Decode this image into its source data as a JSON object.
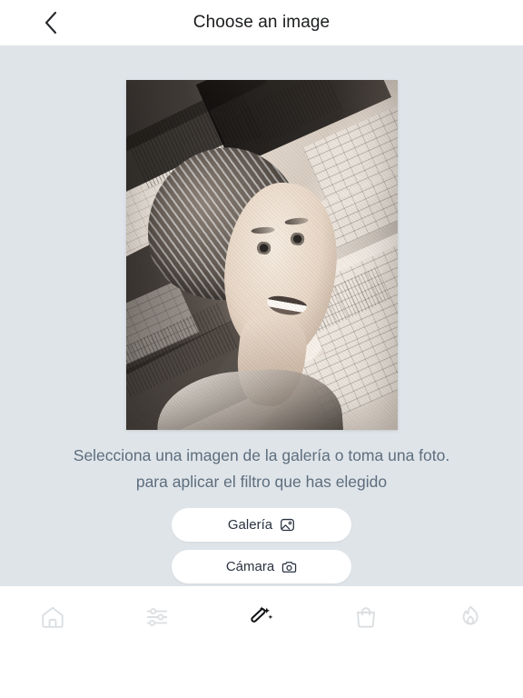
{
  "header": {
    "title": "Choose an image",
    "back_icon": "chevron-left-icon"
  },
  "preview": {
    "alt": "monochrome artistic portrait collage of a smiling woman with braided updo hair over abstract city architecture"
  },
  "caption": {
    "line1": "Selecciona una imagen de la galería o toma una foto.",
    "line2": "para aplicar el filtro que has elegido"
  },
  "actions": [
    {
      "label": "Galería",
      "icon": "image-icon"
    },
    {
      "label": "Cámara",
      "icon": "camera-icon"
    }
  ],
  "bottom_nav": {
    "items": [
      {
        "name": "home",
        "icon": "home-icon",
        "active": false
      },
      {
        "name": "adjustments",
        "icon": "sliders-icon",
        "active": false
      },
      {
        "name": "effects",
        "icon": "magic-wand-icon",
        "active": true
      },
      {
        "name": "shop",
        "icon": "shopping-bag-icon",
        "active": false
      },
      {
        "name": "trending",
        "icon": "flame-icon",
        "active": false
      }
    ]
  },
  "colors": {
    "background": "#dfe4e9",
    "surface": "#ffffff",
    "title_text": "#1a1c1e",
    "caption_text": "#5d6e7d",
    "button_text": "#2b3340",
    "nav_inactive": "#dcdfe2",
    "nav_active": "#111315"
  }
}
